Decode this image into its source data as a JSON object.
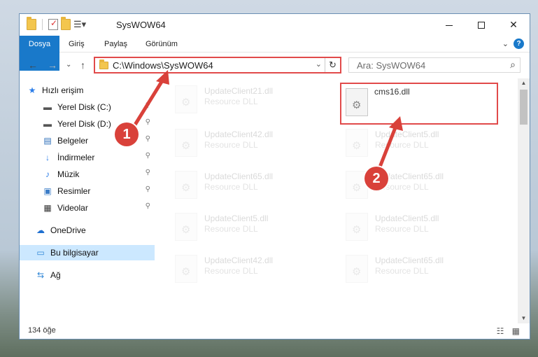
{
  "window": {
    "title": "SysWOW64",
    "caption": {
      "minimize": "—",
      "maximize": "☐",
      "close": "✕"
    }
  },
  "ribbon": {
    "tabs": [
      "Dosya",
      "Giriş",
      "Paylaş",
      "Görünüm"
    ],
    "expand": "⌄",
    "help": "?"
  },
  "nav": {
    "back": "←",
    "forward": "→",
    "recent": "⌄",
    "up": "↑",
    "address": "C:\\Windows\\SysWOW64",
    "dropdown": "⌄",
    "refresh": "↻",
    "search_placeholder": "Ara: SysWOW64",
    "search_icon": "🔍"
  },
  "sidebar": {
    "items": [
      {
        "label": "Hızlı erişim",
        "icon": "star-icon",
        "glyph": "★",
        "color": "#2b7de9"
      },
      {
        "label": "Yerel Disk (C:)",
        "icon": "drive-icon",
        "glyph": "▬",
        "color": "#555555"
      },
      {
        "label": "Yerel Disk (D:)",
        "icon": "drive-icon",
        "glyph": "▬",
        "color": "#555555"
      },
      {
        "label": "Belgeler",
        "icon": "documents-icon",
        "glyph": "▤",
        "color": "#2a6cb8"
      },
      {
        "label": "İndirmeler",
        "icon": "download-icon",
        "glyph": "↓",
        "color": "#2b7de9"
      },
      {
        "label": "Müzik",
        "icon": "music-icon",
        "glyph": "♪",
        "color": "#2b7de9"
      },
      {
        "label": "Resimler",
        "icon": "pictures-icon",
        "glyph": "▣",
        "color": "#3a7cc7"
      },
      {
        "label": "Videolar",
        "icon": "videos-icon",
        "glyph": "▦",
        "color": "#333333"
      },
      {
        "label": "OneDrive",
        "icon": "cloud-icon",
        "glyph": "☁",
        "color": "#1e6fd0"
      },
      {
        "label": "Bu bilgisayar",
        "icon": "computer-icon",
        "glyph": "▭",
        "color": "#2f86d6"
      },
      {
        "label": "Ağ",
        "icon": "network-icon",
        "glyph": "⇆",
        "color": "#2f86d6"
      }
    ],
    "pin": "📌"
  },
  "files": [
    {
      "name": "UpdateClient21.dll",
      "type": "Resource DLL"
    },
    {
      "name": "cms16.dll",
      "type": ""
    },
    {
      "name": "UpdateClient42.dll",
      "type": "Resource DLL"
    },
    {
      "name": "UpdateClient5.dll",
      "type": "Resource DLL"
    },
    {
      "name": "UpdateClient65.dll",
      "type": "Resource DLL"
    },
    {
      "name": "UpdateClient65.dll",
      "type": "Resource DLL"
    },
    {
      "name": "UpdateClient5.dll",
      "type": "Resource DLL"
    },
    {
      "name": "UpdateClient5.dll",
      "type": "Resource DLL"
    },
    {
      "name": "UpdateClient42.dll",
      "type": "Resource DLL"
    },
    {
      "name": "UpdateClient65.dll",
      "type": "Resource DLL"
    }
  ],
  "status": {
    "count": "134 öğe",
    "view_icons": "☷ ▦"
  },
  "callouts": [
    "1",
    "2"
  ],
  "colors": {
    "accent": "#1979ca",
    "highlight": "#e14a4a",
    "callout": "#d9413a"
  }
}
